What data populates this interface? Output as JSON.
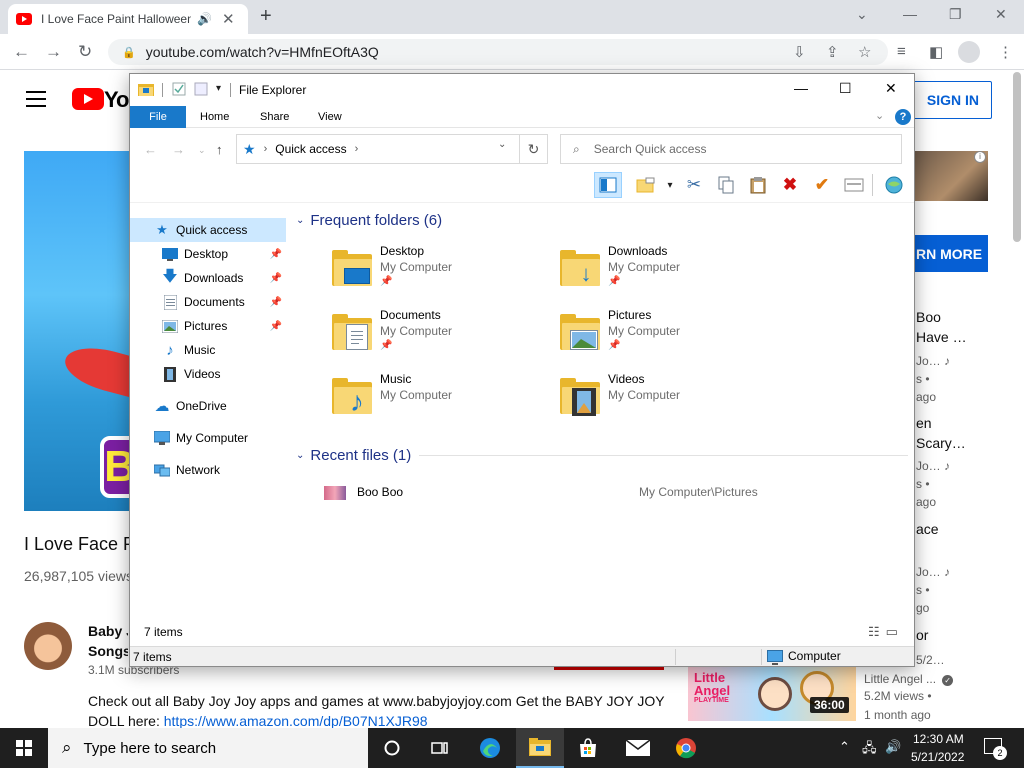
{
  "browser": {
    "tab_title": "I Love Face Paint Halloween",
    "tab_audio_icon": "speaker-icon",
    "tab_close": "✕",
    "new_tab": "+",
    "url": "youtube.com/watch?v=HMfnEOftA3Q"
  },
  "youtube": {
    "logo_text": "You",
    "sign_in": "SIGN IN",
    "learn_more": "RN MORE",
    "video_title": "I Love Face P",
    "views": "26,987,105 views",
    "b_letter": "B",
    "channel_name_line1": "Baby J",
    "channel_name_line2": "Songs",
    "subscribers": "3.1M subscribers",
    "description_line1": "Check out all Baby Joy Joy apps and games at www.babyjoyjoy.com Get the BABY JOY JOY",
    "description_line2_prefix": "DOLL here: ",
    "description_link": "https://www.amazon.com/dp/B07N1XJR98",
    "recommendations": [
      {
        "line1": "Boo",
        "line2": "Have …",
        "line3": "Jo…",
        "line4": "s •",
        "line5": "ago"
      },
      {
        "line1": "en",
        "line2": "Scary…",
        "line3": "Jo…",
        "line4": "s •",
        "line5": "ago"
      },
      {
        "line1": "ace",
        "line3": "Jo…",
        "line4": "s •",
        "line5": "go"
      },
      {
        "line1": "or",
        "line3": "5/2…"
      }
    ],
    "rec_thumb_logo_line1": "Little",
    "rec_thumb_logo_line2": "Angel",
    "rec_thumb_logo_line3": "PLAYTIME",
    "rec_duration": "36:00",
    "rec_channel": "Little Angel ...",
    "rec_views": "5.2M views •",
    "rec_age": "1 month ago"
  },
  "explorer": {
    "title": "File Explorer",
    "ribbon_tabs": [
      "File",
      "Home",
      "Share",
      "View"
    ],
    "help": "?",
    "address_location": "Quick access",
    "search_placeholder": "Search Quick access",
    "nav": [
      {
        "label": "Quick access",
        "icon": "star-icon",
        "pinned": false,
        "selected": true
      },
      {
        "label": "Desktop",
        "icon": "desktop-icon",
        "pinned": true
      },
      {
        "label": "Downloads",
        "icon": "download-arrow-icon",
        "pinned": true
      },
      {
        "label": "Documents",
        "icon": "document-icon",
        "pinned": true
      },
      {
        "label": "Pictures",
        "icon": "pictures-icon",
        "pinned": true
      },
      {
        "label": "Music",
        "icon": "music-note-icon",
        "pinned": false
      },
      {
        "label": "Videos",
        "icon": "film-icon",
        "pinned": false
      },
      {
        "label": "OneDrive",
        "icon": "cloud-icon",
        "pinned": false
      },
      {
        "label": "My Computer",
        "icon": "computer-icon",
        "pinned": false
      },
      {
        "label": "Network",
        "icon": "network-icon",
        "pinned": false
      }
    ],
    "frequent_header": "Frequent folders (6)",
    "frequent": [
      {
        "name": "Desktop",
        "location": "My Computer",
        "pinned": true
      },
      {
        "name": "Downloads",
        "location": "My Computer",
        "pinned": true
      },
      {
        "name": "Documents",
        "location": "My Computer",
        "pinned": true
      },
      {
        "name": "Pictures",
        "location": "My Computer",
        "pinned": true
      },
      {
        "name": "Music",
        "location": "My Computer",
        "pinned": false
      },
      {
        "name": "Videos",
        "location": "My Computer",
        "pinned": false
      }
    ],
    "recent_header": "Recent files (1)",
    "recent": [
      {
        "name": "Boo Boo",
        "path": "My Computer\\Pictures"
      }
    ],
    "item_count": "7 items",
    "status_items": "7 items",
    "status_location": "Computer"
  },
  "taskbar": {
    "search_placeholder": "Type here to search",
    "time": "12:30 AM",
    "date": "5/21/2022",
    "notification_count": "2"
  },
  "colors": {
    "accent": "#1979ca",
    "youtube_red": "#ff0000",
    "link_blue": "#065fd4",
    "selection": "#cce8ff",
    "group_header": "#1e3287"
  }
}
